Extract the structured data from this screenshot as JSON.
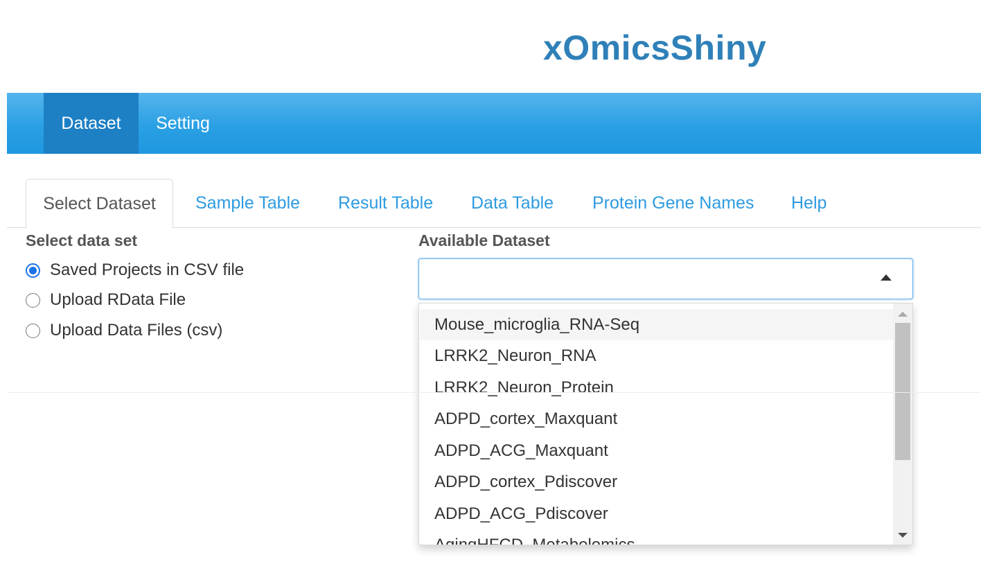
{
  "app": {
    "title": "xOmicsShiny"
  },
  "navbar": {
    "items": [
      {
        "label": "Dataset",
        "active": true
      },
      {
        "label": "Setting",
        "active": false
      }
    ]
  },
  "tabs": [
    {
      "label": "Select Dataset",
      "active": true
    },
    {
      "label": "Sample Table",
      "active": false
    },
    {
      "label": "Result Table",
      "active": false
    },
    {
      "label": "Data Table",
      "active": false
    },
    {
      "label": "Protein Gene Names",
      "active": false
    },
    {
      "label": "Help",
      "active": false
    }
  ],
  "select_data_set": {
    "label": "Select data set",
    "options": [
      {
        "label": "Saved Projects in CSV file",
        "checked": true
      },
      {
        "label": "Upload RData File",
        "checked": false
      },
      {
        "label": "Upload Data Files (csv)",
        "checked": false
      }
    ]
  },
  "available_dataset": {
    "label": "Available Dataset",
    "value": "",
    "dropdown_open": true,
    "options": [
      "Mouse_microglia_RNA-Seq",
      "LRRK2_Neuron_RNA",
      "LRRK2_Neuron_Protein",
      "ADPD_cortex_Maxquant",
      "ADPD_ACG_Maxquant",
      "ADPD_cortex_Pdiscover",
      "ADPD_ACG_Pdiscover",
      "AgingHFCD_Metabolomics"
    ],
    "highlighted_index": 0
  },
  "colors": {
    "title": "#2f80b8",
    "navbar": "#2aa0e4",
    "navbar_active": "#1d80c4",
    "tab_link": "#2e9be0",
    "radio_checked": "#1a73e8"
  }
}
